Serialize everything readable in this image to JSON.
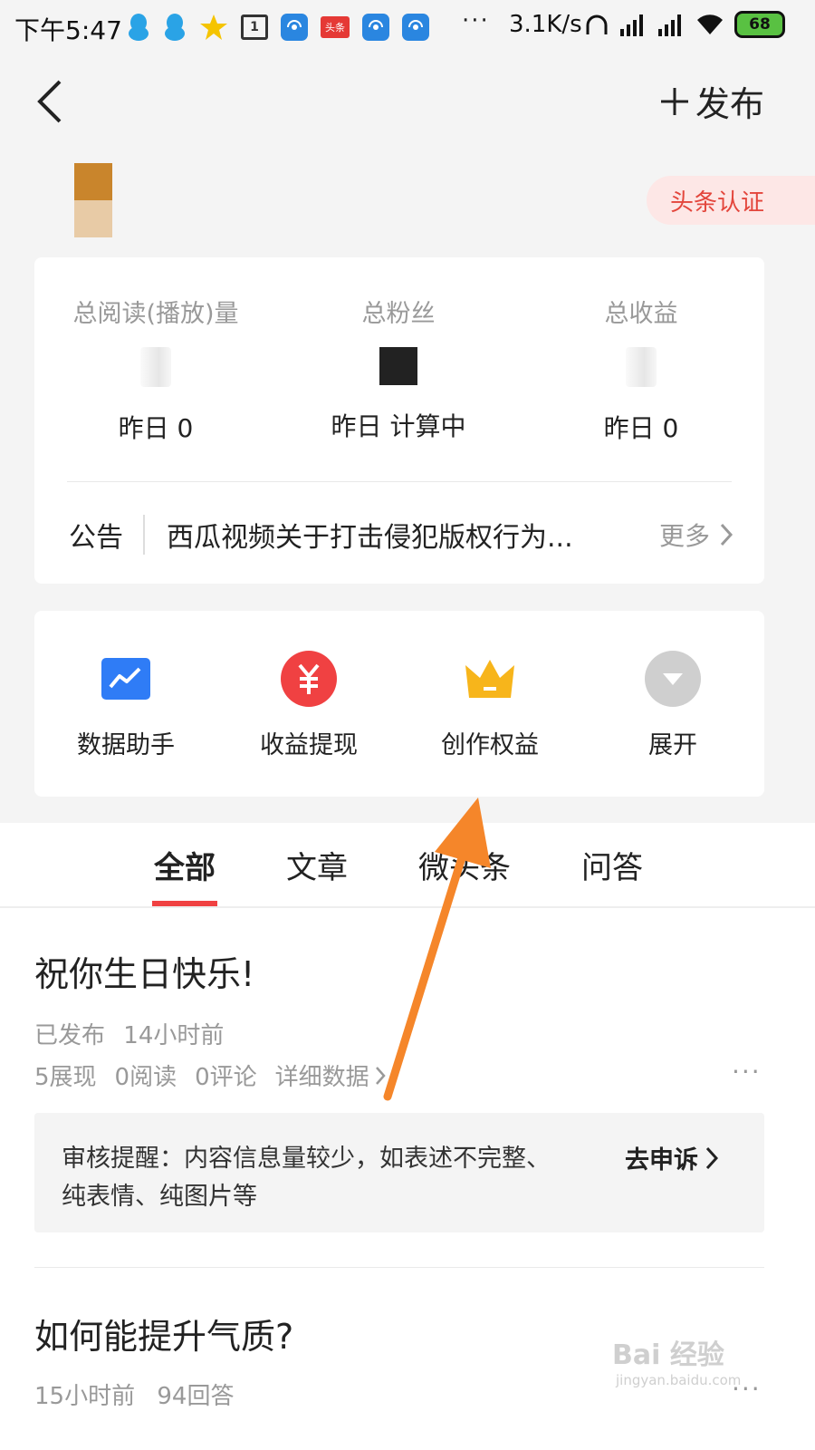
{
  "status_bar": {
    "time": "下午5:47",
    "more": "···",
    "speed": "3.1K/s",
    "tt_label": "头条",
    "calendar_num": "1",
    "battery": "68"
  },
  "header": {
    "publish_label": "发布"
  },
  "profile": {
    "cert_label": "头条认证"
  },
  "stats": {
    "items": [
      {
        "label": "总阅读(播放)量",
        "sub": "昨日 0"
      },
      {
        "label": "总粉丝",
        "sub": "昨日 计算中"
      },
      {
        "label": "总收益",
        "sub": "昨日 0"
      }
    ]
  },
  "notice": {
    "label": "公告",
    "text": "西瓜视频关于打击侵犯版权行为...",
    "more": "更多"
  },
  "tools": [
    {
      "label": "数据助手",
      "icon": "chart-icon",
      "color": "#2f7cf6"
    },
    {
      "label": "收益提现",
      "icon": "yuan-icon",
      "color": "#f04142"
    },
    {
      "label": "创作权益",
      "icon": "crown-icon",
      "color": "#f7b51b"
    },
    {
      "label": "展开",
      "icon": "expand-icon",
      "color": "#cfcfcf"
    }
  ],
  "tabs": [
    "全部",
    "文章",
    "微头条",
    "问答"
  ],
  "posts": [
    {
      "title": "祝你生日快乐!",
      "status": "已发布",
      "time": "14小时前",
      "stats": [
        "5展现",
        "0阅读",
        "0评论",
        "详细数据"
      ],
      "review_text": "审核提醒：内容信息量较少，如表述不完整、纯表情、纯图片等",
      "appeal_label": "去申诉"
    },
    {
      "title": "如何能提升气质?",
      "time": "15小时前",
      "answers": "94回答"
    }
  ],
  "watermark": {
    "text": "Bai 经验",
    "sub": "jingyan.baidu.com"
  },
  "colors": {
    "accent": "#f04142",
    "arrow": "#f5862a"
  }
}
